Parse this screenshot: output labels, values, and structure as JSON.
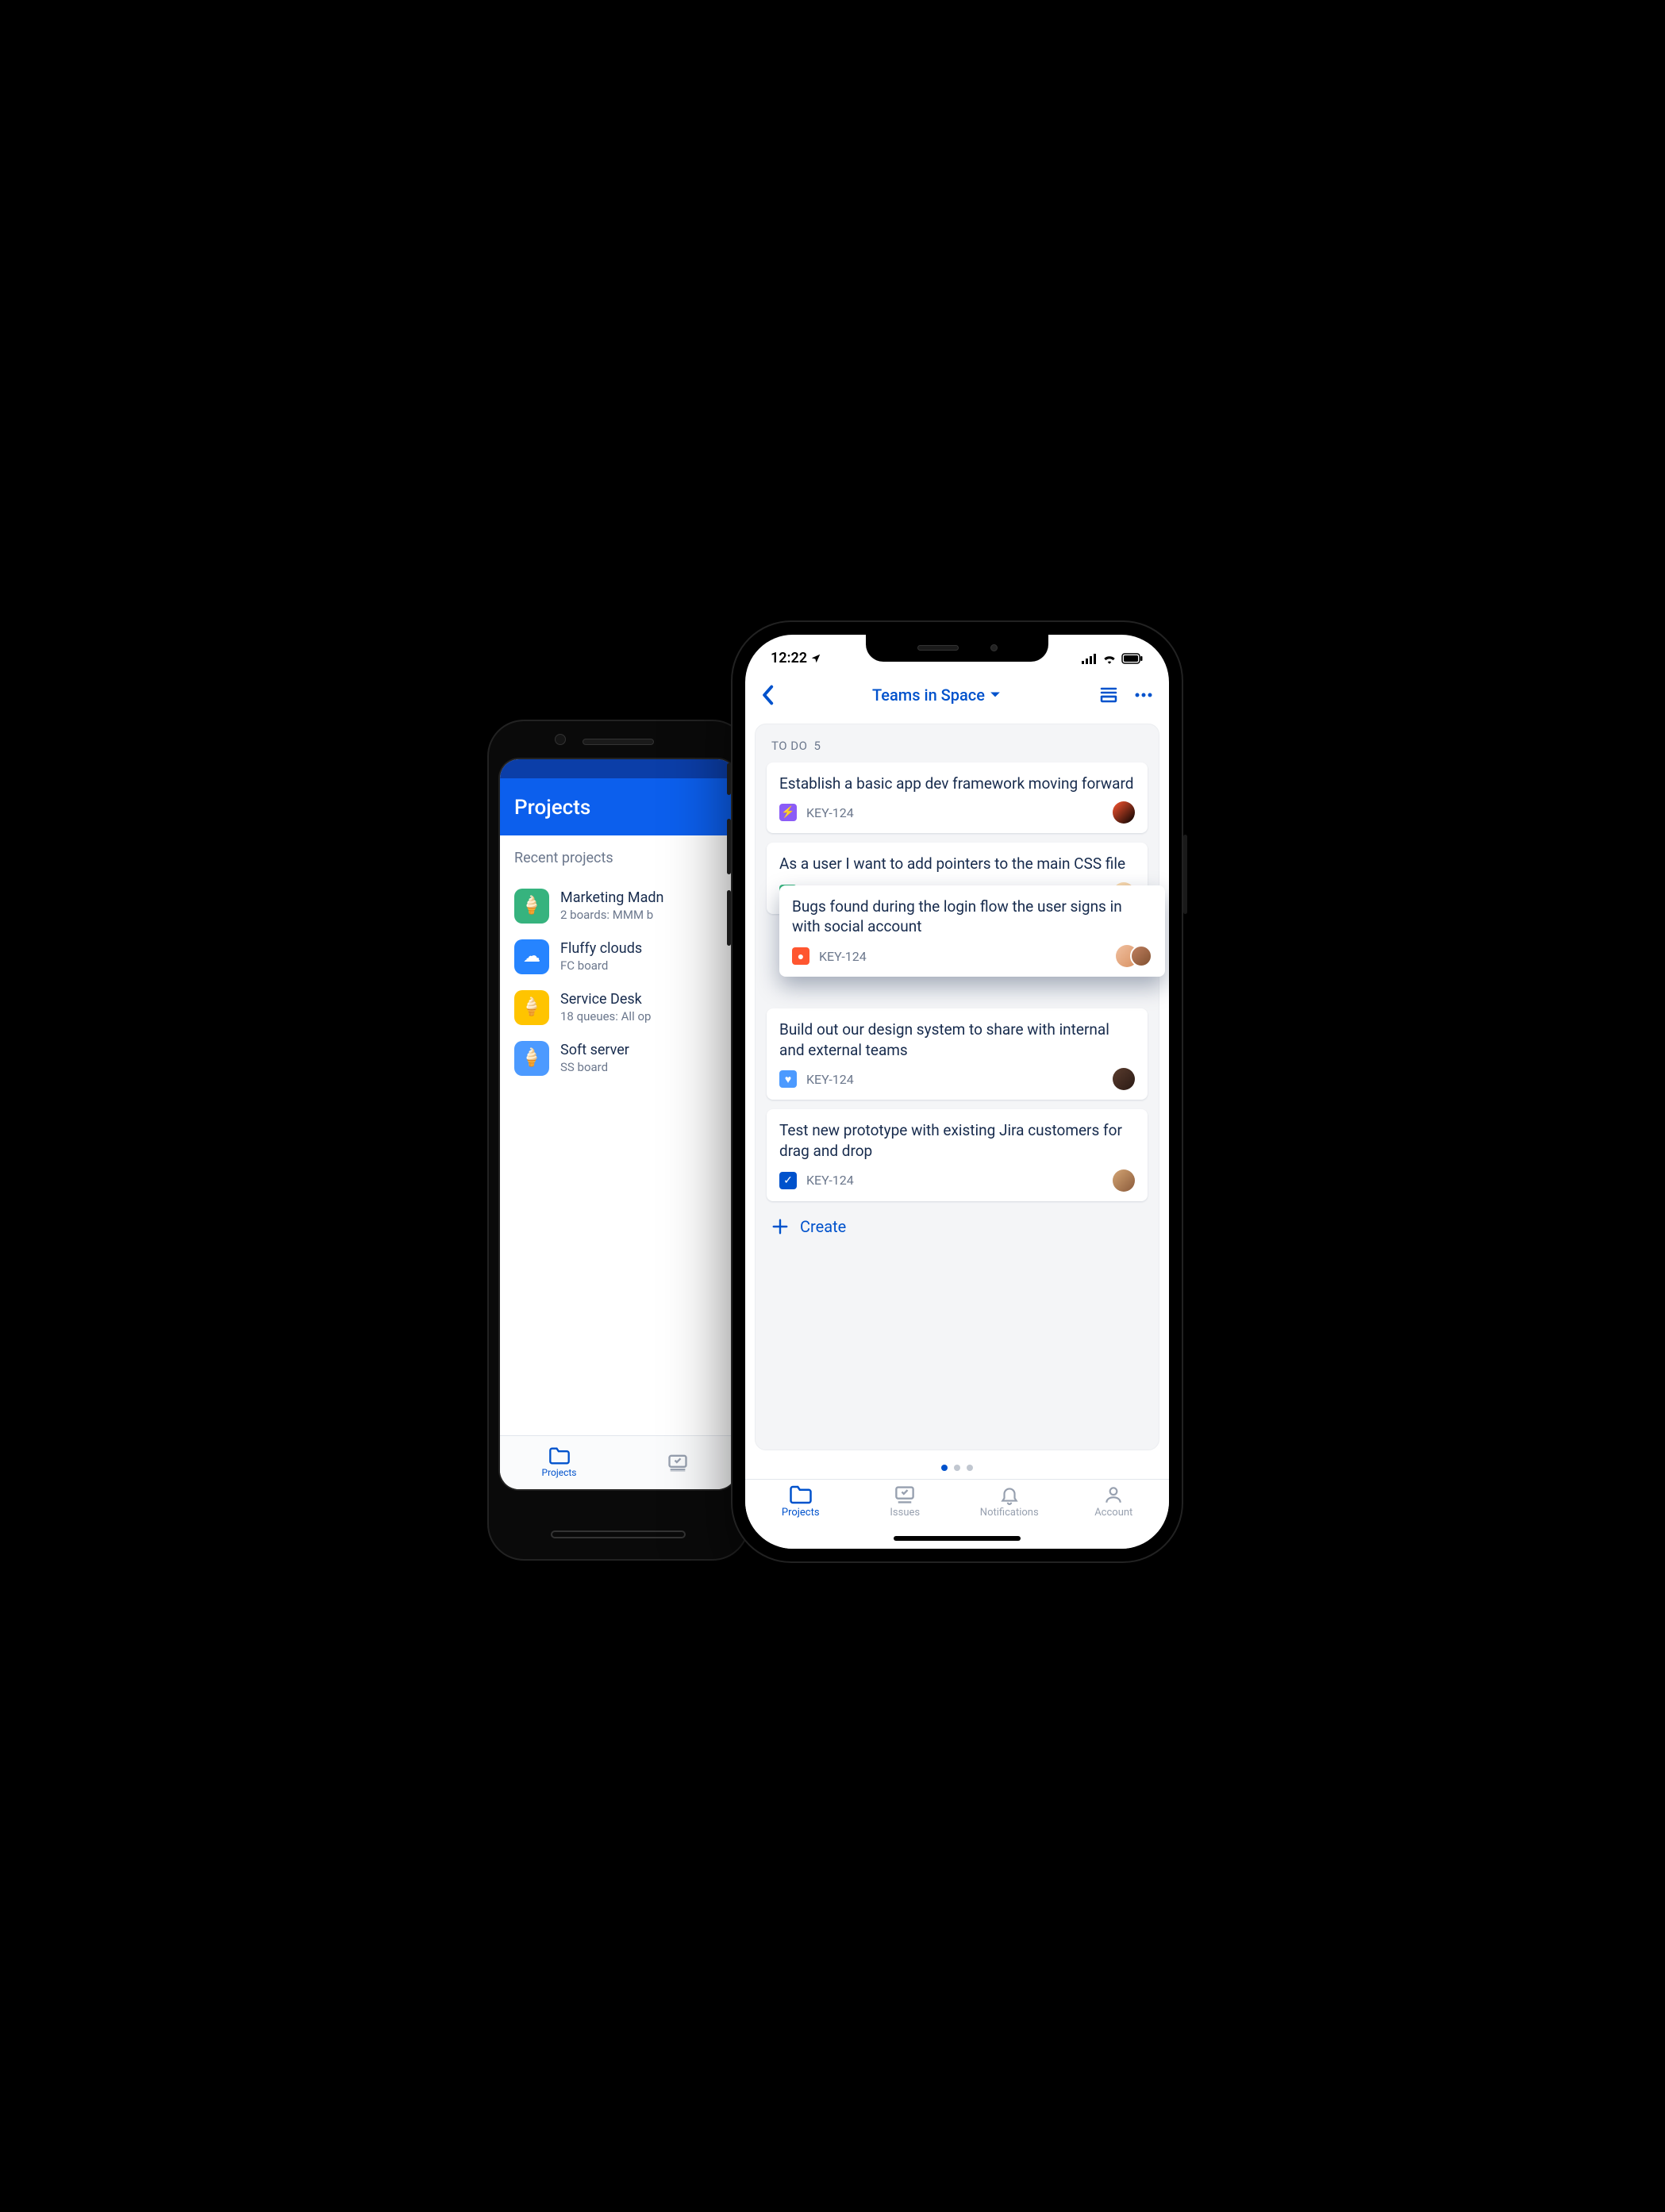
{
  "android": {
    "header_title": "Projects",
    "section_label": "Recent projects",
    "projects": [
      {
        "name": "Marketing Madn",
        "subtitle": "2 boards: MMM b",
        "icon_bg": "#36b37e",
        "icon_glyph": "🍦"
      },
      {
        "name": "Fluffy clouds",
        "subtitle": "FC board",
        "icon_bg": "#2684ff",
        "icon_glyph": "☁"
      },
      {
        "name": "Service Desk",
        "subtitle": "18 queues: All op",
        "icon_bg": "#ffc400",
        "icon_glyph": "🍦"
      },
      {
        "name": "Soft server",
        "subtitle": "SS board",
        "icon_bg": "#4c9aff",
        "icon_glyph": "🍦"
      }
    ],
    "tabs": {
      "projects": "Projects"
    }
  },
  "ios": {
    "status_time": "12:22",
    "nav_title": "Teams in Space",
    "column": {
      "label": "TO DO",
      "count": "5"
    },
    "cards": [
      {
        "title": "Establish a basic app dev framework moving forward",
        "key": "KEY-124",
        "type_color": "#8b5cf6",
        "type_glyph": "⚡",
        "avatar_bg": "linear-gradient(135deg,#ff5630,#000)"
      },
      {
        "title": "As a user I want to add pointers to the main CSS file",
        "key": "KEY-124",
        "type_color": "#36b37e",
        "type_glyph": "◑",
        "avatar_bg": "linear-gradient(135deg,#ffe0b2,#e8c19a)"
      },
      {
        "title": "Bugs found during the login flow the user signs in with social account",
        "key": "KEY-124",
        "type_color": "#ff5630",
        "type_glyph": "●",
        "dragging": true,
        "pair": true
      },
      {
        "title": "Build out our design system to share with internal and external teams",
        "key": "KEY-124",
        "type_color": "#4c9aff",
        "type_glyph": "♥",
        "avatar_bg": "linear-gradient(135deg,#5a3c2e,#2a1a14)"
      },
      {
        "title": "Test new prototype with existing Jira customers for drag and drop",
        "key": "KEY-124",
        "type_color": "#0052cc",
        "type_glyph": "✓",
        "avatar_bg": "linear-gradient(135deg,#d4a574,#8a5a3a)"
      }
    ],
    "create_label": "Create",
    "tabs": {
      "projects": "Projects",
      "issues": "Issues",
      "notifications": "Notifications",
      "account": "Account"
    }
  }
}
